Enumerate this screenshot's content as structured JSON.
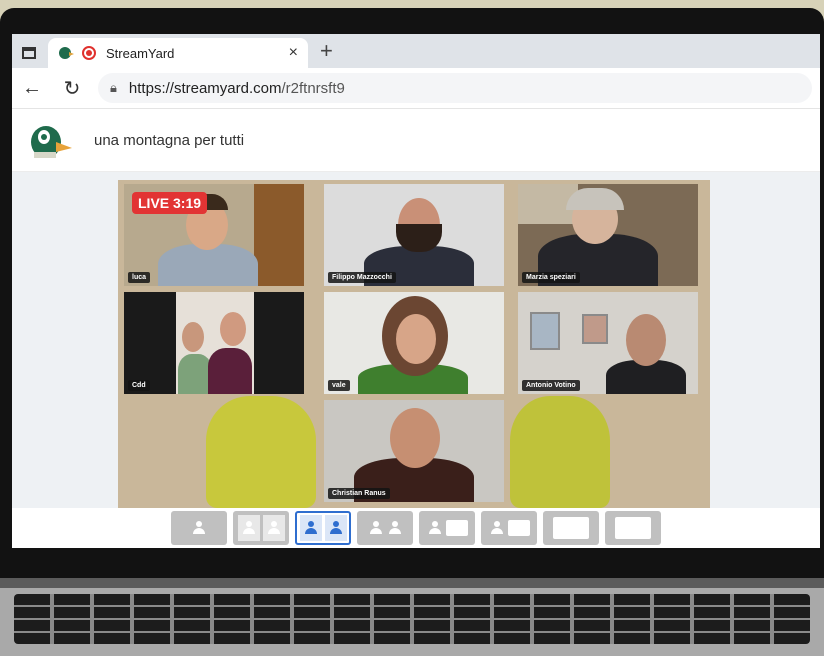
{
  "browser": {
    "tab": {
      "title": "StreamYard",
      "close": "×"
    },
    "new_tab": "+",
    "nav": {
      "back": "←",
      "reload": "↻"
    },
    "url": {
      "host": "https://streamyard.com",
      "path": "/r2ftnrsft9"
    }
  },
  "header": {
    "broadcast_title": "una montagna per tutti"
  },
  "stage": {
    "live_badge": "LIVE 3:19",
    "participants": [
      {
        "name": "luca"
      },
      {
        "name": "Filippo Mazzocchi"
      },
      {
        "name": "Marzia speziari"
      },
      {
        "name": "Cdd"
      },
      {
        "name": "vale"
      },
      {
        "name": "Antonio Votino"
      },
      {
        "name": "Christian Ranus"
      }
    ]
  },
  "layouts": {
    "selected_index": 2,
    "options": [
      "solo",
      "cropped",
      "group",
      "group-with-side",
      "spotlight",
      "news",
      "screen-small",
      "screen-only"
    ]
  },
  "colors": {
    "live": "#e23434",
    "accent": "#2f6ecf"
  }
}
